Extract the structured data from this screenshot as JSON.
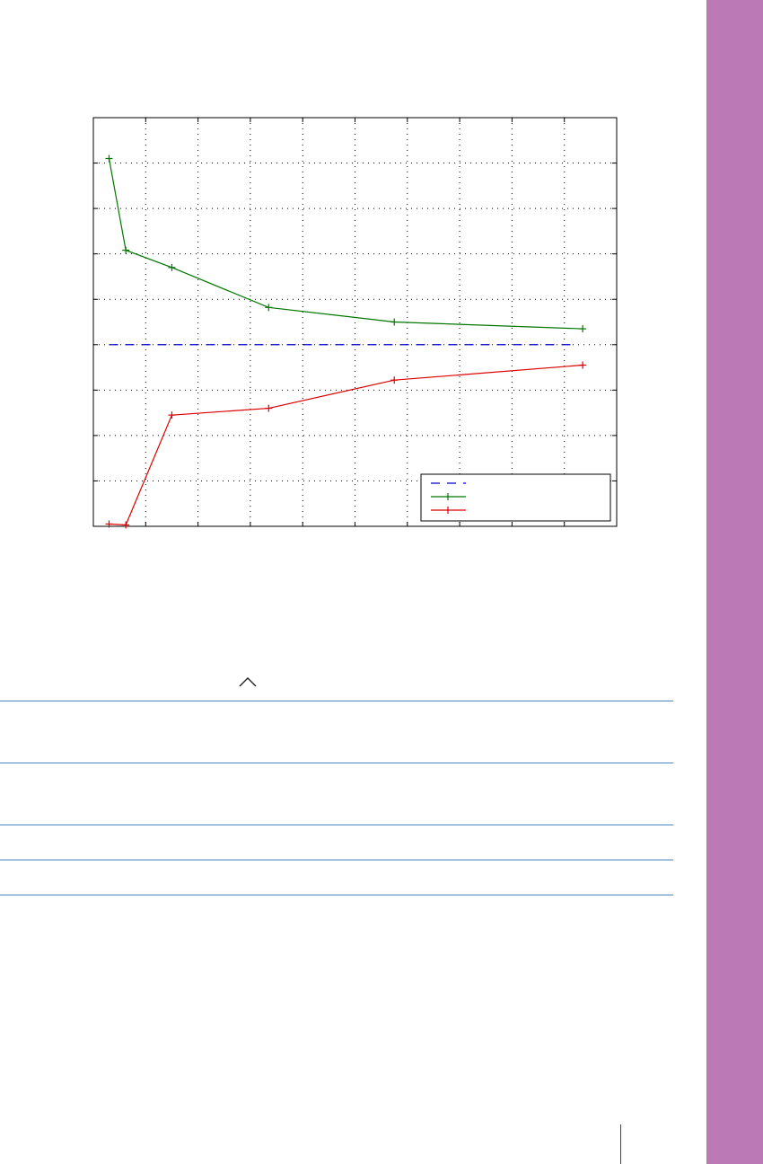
{
  "theme": {
    "side_band_color": "#bb7ab5",
    "rule_color": "#4a86c5"
  },
  "table": {
    "sort_icon": "chevron-up-icon",
    "rule_count": 4
  },
  "chart_data": {
    "type": "line",
    "title": "",
    "xlabel": "",
    "ylabel": "",
    "xlim": [
      0,
      10
    ],
    "ylim": [
      0,
      9
    ],
    "grid": true,
    "legend_position": "bottom-right",
    "series": [
      {
        "key": "baseline",
        "color": "#0000cc",
        "style": "dashed",
        "marker": "none",
        "x": [
          0.3,
          9.2
        ],
        "y": [
          4.0,
          4.0
        ]
      },
      {
        "key": "upper",
        "color": "#007700",
        "style": "solid",
        "marker": "plus",
        "x": [
          0.3,
          0.62,
          1.5,
          3.35,
          5.75,
          9.35
        ],
        "y": [
          8.1,
          6.08,
          5.7,
          4.82,
          4.5,
          4.35
        ]
      },
      {
        "key": "lower",
        "color": "#dd0000",
        "style": "solid",
        "marker": "plus",
        "x": [
          0.3,
          0.62,
          1.5,
          3.35,
          5.75,
          9.35
        ],
        "y": [
          0.05,
          0.03,
          2.45,
          2.6,
          3.22,
          3.55
        ]
      }
    ]
  }
}
